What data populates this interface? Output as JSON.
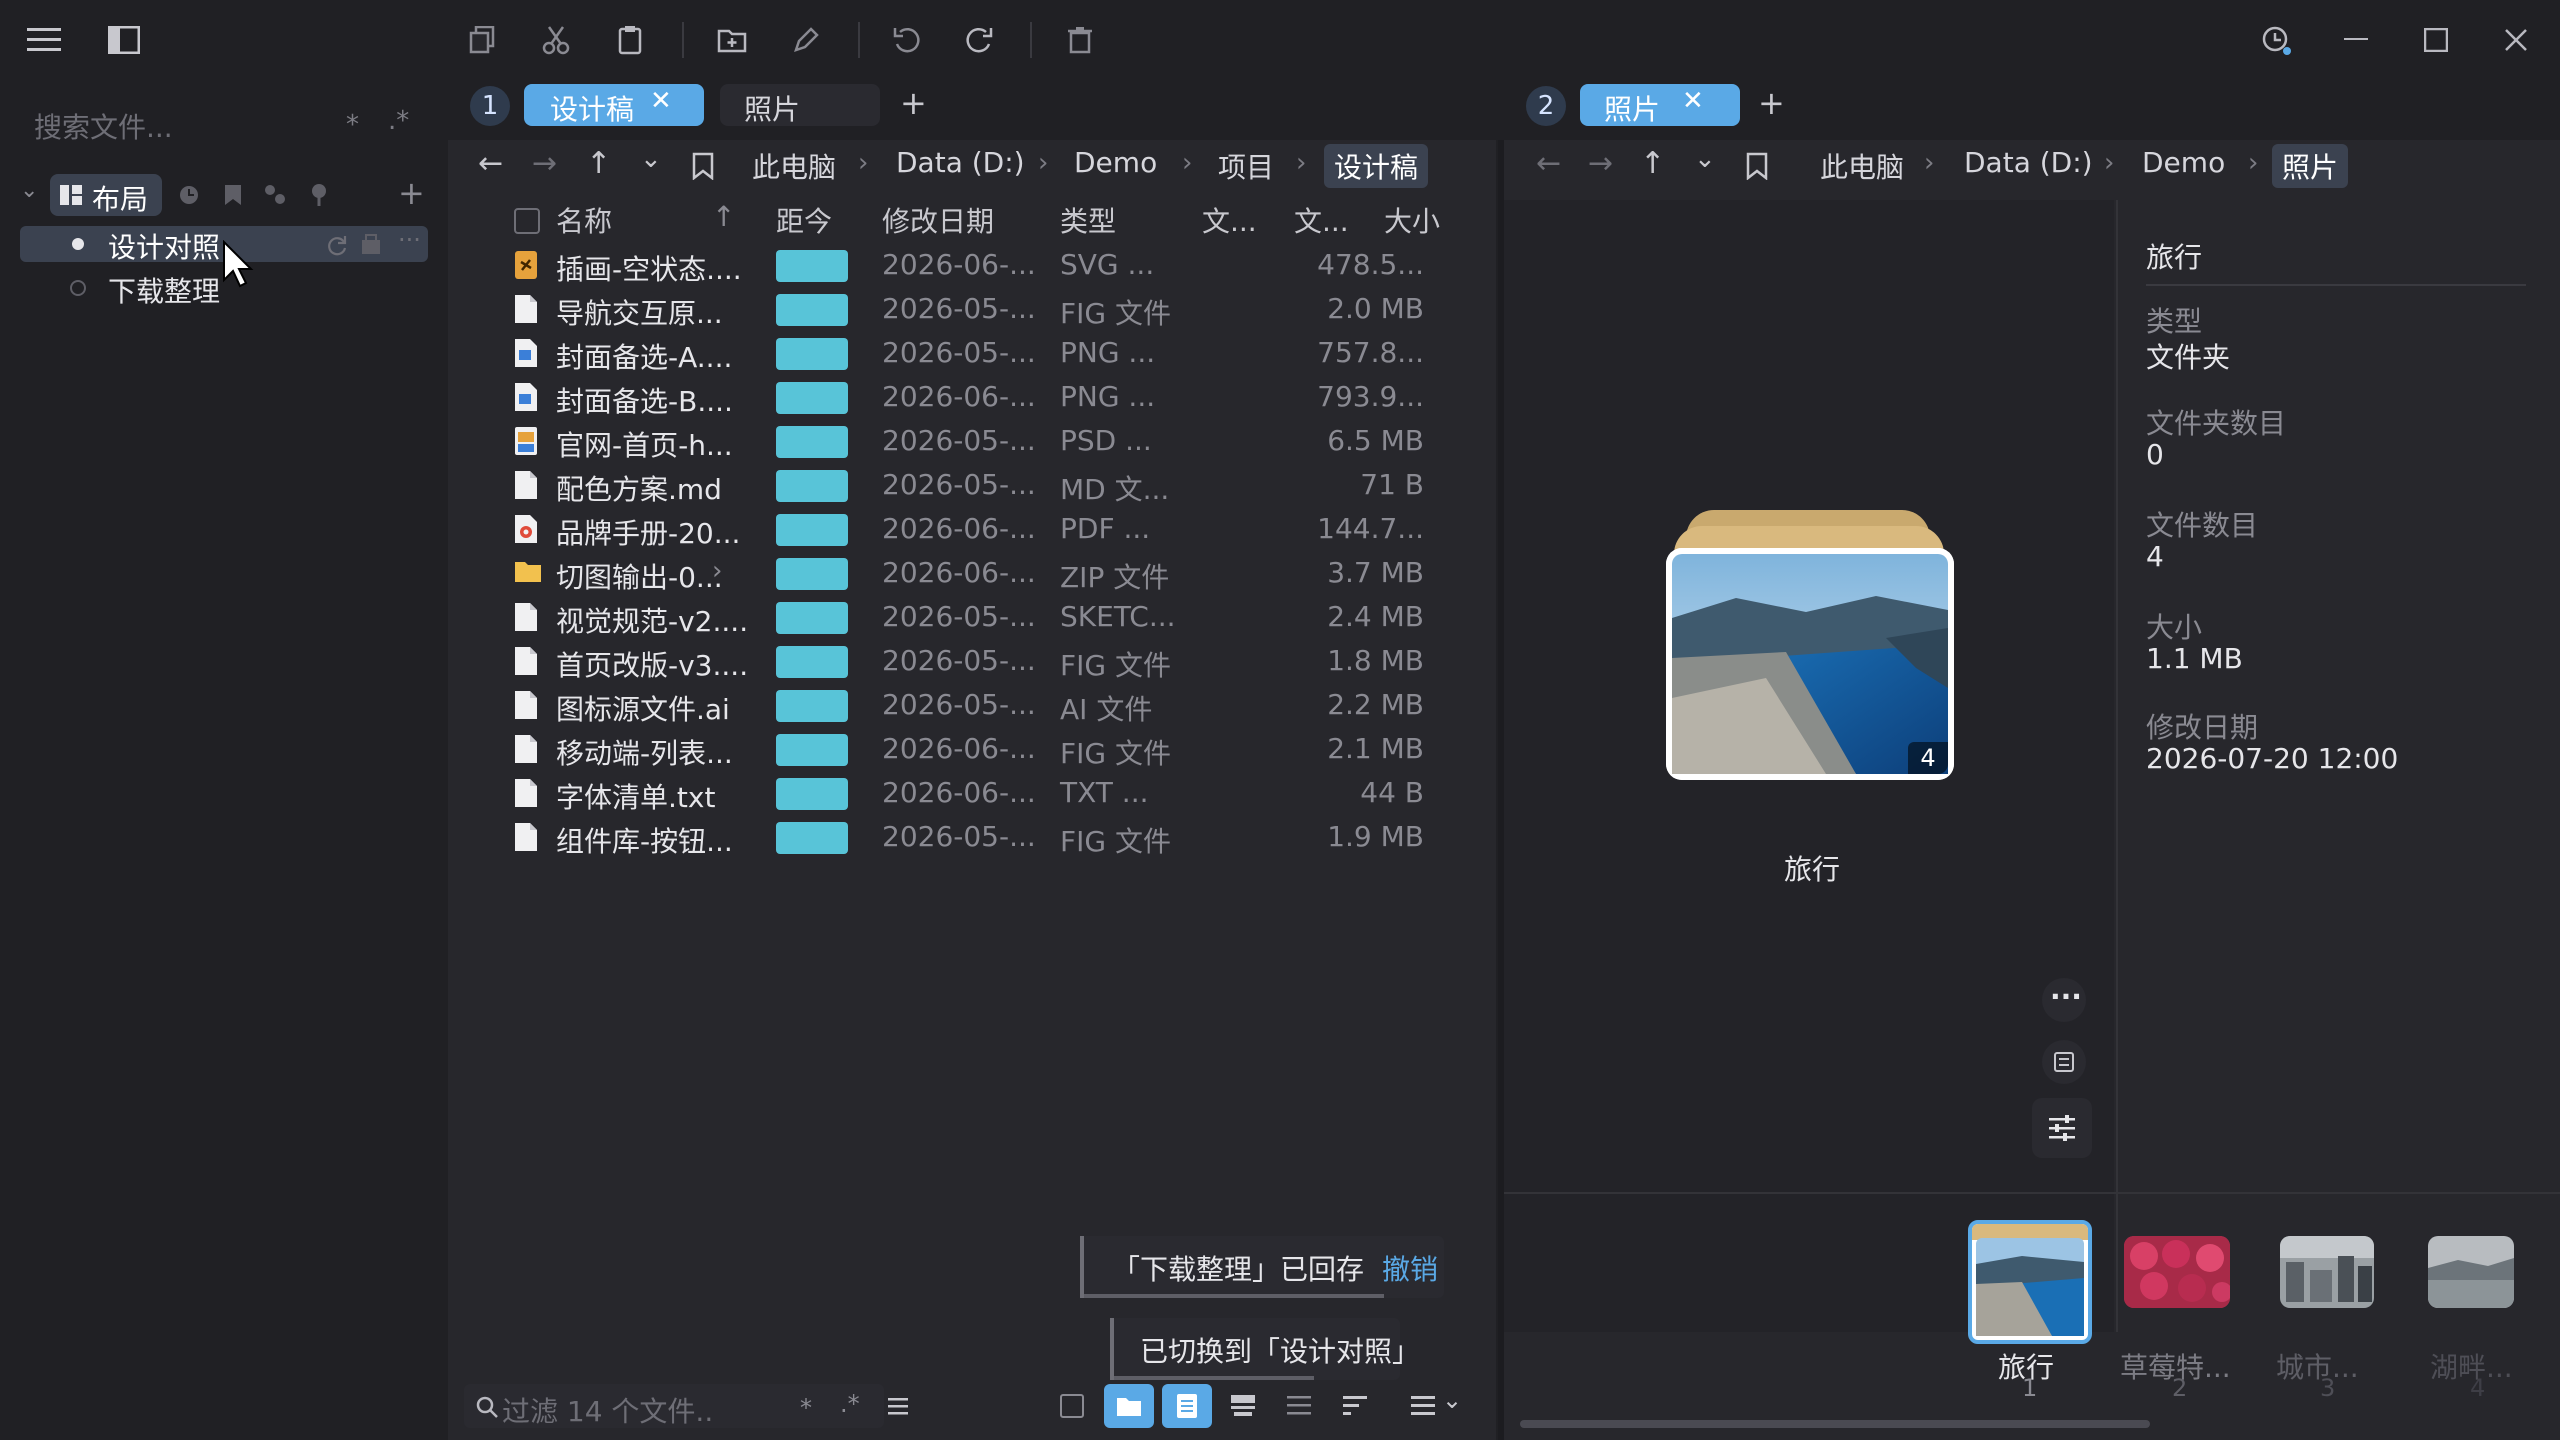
{
  "sidebar": {
    "search_placeholder": "搜索文件...",
    "search_star": "*",
    "search_regex": ".*",
    "layout_button": "布局",
    "items": [
      {
        "label": "设计对照",
        "active": true
      },
      {
        "label": "下载整理",
        "active": false
      }
    ]
  },
  "left": {
    "pane_number": "1",
    "tabs": [
      {
        "label": "设计稿",
        "active": true
      },
      {
        "label": "照片",
        "active": false
      }
    ],
    "add_tab": "+",
    "breadcrumb": [
      "此电脑",
      "Data (D:)",
      "Demo",
      "项目",
      "设计稿"
    ],
    "columns": {
      "name": "名称",
      "age": "距今",
      "modified": "修改日期",
      "type": "类型",
      "col5": "文...",
      "col6": "文...",
      "size": "大小"
    },
    "files": [
      {
        "name": "插画-空状态....",
        "date": "2026-06-...",
        "type": "SVG ...",
        "size": "478.5...",
        "icon": "svg-file-icon"
      },
      {
        "name": "导航交互原...",
        "date": "2026-05-...",
        "type": "FIG 文件",
        "size": "2.0 MB",
        "icon": "document-icon"
      },
      {
        "name": "封面备选-A....",
        "date": "2026-05-...",
        "type": "PNG ...",
        "size": "757.8...",
        "icon": "image-file-icon"
      },
      {
        "name": "封面备选-B....",
        "date": "2026-06-...",
        "type": "PNG ...",
        "size": "793.9...",
        "icon": "image-file-icon"
      },
      {
        "name": "官网-首页-h...",
        "date": "2026-05-...",
        "type": "PSD ...",
        "size": "6.5 MB",
        "icon": "psd-file-icon"
      },
      {
        "name": "配色方案.md",
        "date": "2026-05-...",
        "type": "MD 文...",
        "size": "71 B",
        "icon": "document-icon"
      },
      {
        "name": "品牌手册-20...",
        "date": "2026-06-...",
        "type": "PDF ...",
        "size": "144.7...",
        "icon": "pdf-file-icon"
      },
      {
        "name": "切图输出-0...",
        "date": "2026-06-...",
        "type": "ZIP 文件",
        "size": "3.7 MB",
        "icon": "folder-icon"
      },
      {
        "name": "视觉规范-v2....",
        "date": "2026-05-...",
        "type": "SKETC...",
        "size": "2.4 MB",
        "icon": "document-icon"
      },
      {
        "name": "首页改版-v3....",
        "date": "2026-05-...",
        "type": "FIG 文件",
        "size": "1.8 MB",
        "icon": "document-icon"
      },
      {
        "name": "图标源文件.ai",
        "date": "2026-05-...",
        "type": "AI 文件",
        "size": "2.2 MB",
        "icon": "document-icon"
      },
      {
        "name": "移动端-列表...",
        "date": "2026-06-...",
        "type": "FIG 文件",
        "size": "2.1 MB",
        "icon": "document-icon"
      },
      {
        "name": "字体清单.txt",
        "date": "2026-06-...",
        "type": "TXT ...",
        "size": "44 B",
        "icon": "document-icon"
      },
      {
        "name": "组件库-按钮...",
        "date": "2026-05-...",
        "type": "FIG 文件",
        "size": "1.9 MB",
        "icon": "document-icon"
      }
    ],
    "filter_placeholder": "过滤 14 个文件..",
    "filter_star": "*",
    "filter_regex": ".*"
  },
  "toasts": {
    "restore_text": "「下载整理」已回存",
    "undo_label": "撤销",
    "switch_text": "已切换到「设计对照」"
  },
  "right": {
    "pane_number": "2",
    "tabs": [
      {
        "label": "照片",
        "active": true
      }
    ],
    "add_tab": "+",
    "breadcrumb": [
      "此电脑",
      "Data (D:)",
      "Demo",
      "照片"
    ],
    "preview_title": "旅行",
    "preview_badge": "4",
    "info": {
      "title": "旅行",
      "type_label": "类型",
      "type_value": "文件夹",
      "folders_label": "文件夹数目",
      "folders_value": "0",
      "files_label": "文件数目",
      "files_value": "4",
      "size_label": "大小",
      "size_value": "1.1 MB",
      "modified_label": "修改日期",
      "modified_value": "2026-07-20 12:00"
    },
    "thumbs": [
      {
        "label": "旅行",
        "index": "1"
      },
      {
        "label": "草莓特...",
        "index": "2"
      },
      {
        "label": "城市...",
        "index": "3"
      },
      {
        "label": "湖畔...",
        "index": "4"
      }
    ]
  },
  "colors": {
    "accent": "#5aa9e6",
    "age_bar": "#58c4d8",
    "background": "#202024",
    "pane": "#27272c"
  }
}
